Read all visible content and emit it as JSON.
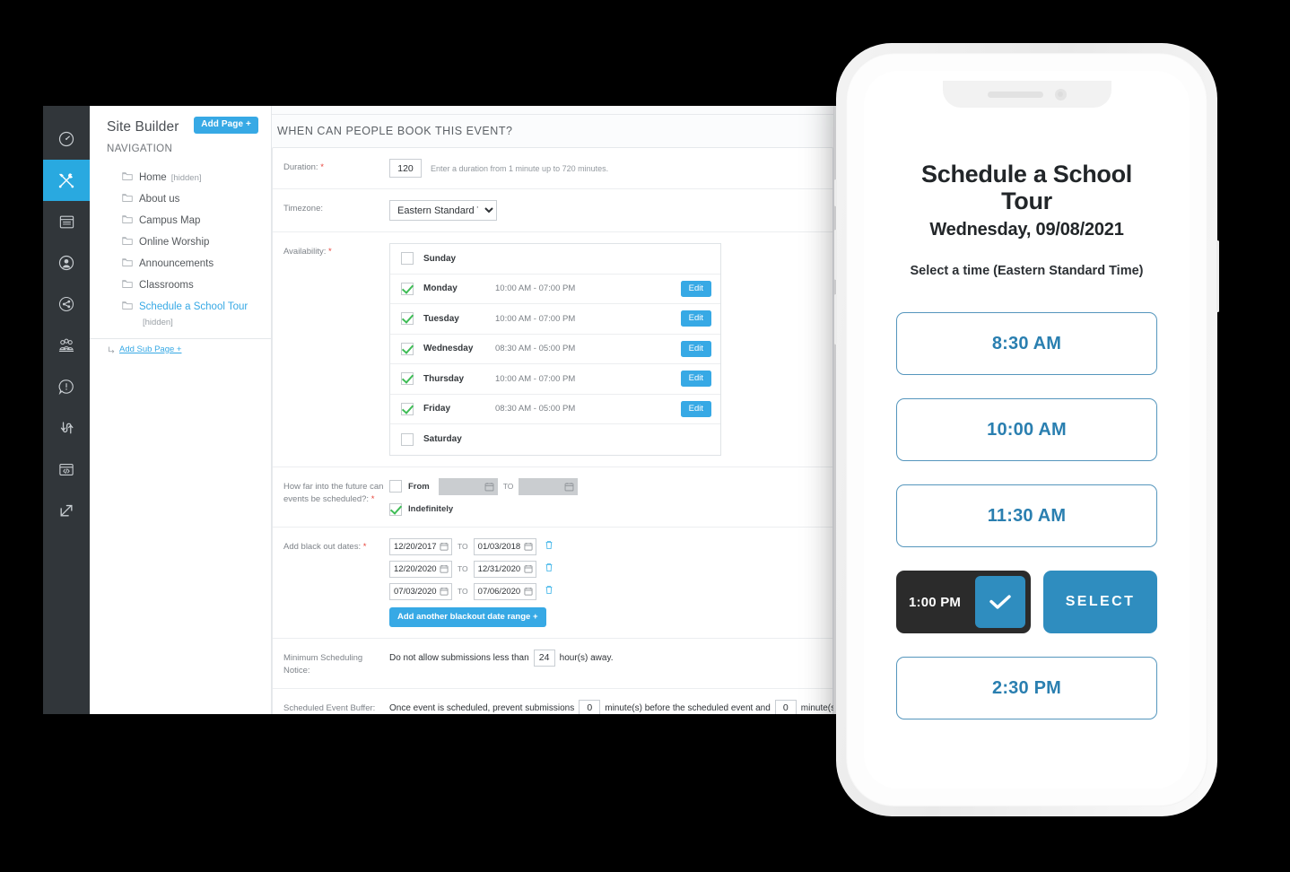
{
  "browser": {
    "rail": [
      {
        "name": "dashboard-icon",
        "label": "Dashboard",
        "active": false
      },
      {
        "name": "tools-icon",
        "label": "Site Builder",
        "active": true
      },
      {
        "name": "pages-icon",
        "label": "Pages",
        "active": false
      },
      {
        "name": "user-icon",
        "label": "Users",
        "active": false
      },
      {
        "name": "share-icon",
        "label": "Share",
        "active": false
      },
      {
        "name": "group-icon",
        "label": "Groups",
        "active": false
      },
      {
        "name": "alert-icon",
        "label": "Alerts",
        "active": false
      },
      {
        "name": "transfer-icon",
        "label": "Transfer",
        "active": false
      },
      {
        "name": "code-icon",
        "label": "Code",
        "active": false
      },
      {
        "name": "external-link-icon",
        "label": "Open Site",
        "active": false
      }
    ],
    "sidebar": {
      "title": "Site Builder",
      "add_page_label": "Add Page +",
      "nav_heading": "NAVIGATION",
      "add_sub_page_label": "Add Sub Page +",
      "items": [
        {
          "label": "Home",
          "tag": "[hidden]",
          "selected": false
        },
        {
          "label": "About us",
          "tag": "",
          "selected": false
        },
        {
          "label": "Campus Map",
          "tag": "",
          "selected": false
        },
        {
          "label": "Online Worship",
          "tag": "",
          "selected": false
        },
        {
          "label": "Announcements",
          "tag": "",
          "selected": false
        },
        {
          "label": "Classrooms",
          "tag": "",
          "selected": false
        },
        {
          "label": "Schedule a School Tour",
          "tag": "",
          "selected": true,
          "sub_tag": "[hidden]"
        }
      ]
    },
    "form": {
      "section_title": "WHEN CAN PEOPLE BOOK THIS EVENT?",
      "duration": {
        "label": "Duration:",
        "required": true,
        "value": "120",
        "hint": "Enter a duration from 1 minute up to 720 minutes."
      },
      "timezone": {
        "label": "Timezone:",
        "required": false,
        "value": "Eastern Standard Time",
        "options": [
          "Eastern Standard Time"
        ]
      },
      "availability": {
        "label": "Availability:",
        "required": true,
        "edit_label": "Edit",
        "days": [
          {
            "day": "Sunday",
            "checked": false,
            "time": "",
            "has_edit": false
          },
          {
            "day": "Monday",
            "checked": true,
            "time": "10:00 AM - 07:00 PM",
            "has_edit": true
          },
          {
            "day": "Tuesday",
            "checked": true,
            "time": "10:00 AM - 07:00 PM",
            "has_edit": true
          },
          {
            "day": "Wednesday",
            "checked": true,
            "time": "08:30 AM - 05:00 PM",
            "has_edit": true
          },
          {
            "day": "Thursday",
            "checked": true,
            "time": "10:00 AM - 07:00 PM",
            "has_edit": true
          },
          {
            "day": "Friday",
            "checked": true,
            "time": "08:30 AM - 05:00 PM",
            "has_edit": true
          },
          {
            "day": "Saturday",
            "checked": false,
            "time": "",
            "has_edit": false
          }
        ]
      },
      "future": {
        "label": "How far into the future can events be scheduled?:",
        "required": true,
        "from_label": "From",
        "from_checked": false,
        "from_value": "",
        "to_label": "TO",
        "to_value": "",
        "indefinitely_label": "Indefinitely",
        "indefinitely_checked": true
      },
      "blackout": {
        "label": "Add black out dates:",
        "required": true,
        "to_label": "TO",
        "add_button_label": "Add another blackout date range +",
        "ranges": [
          {
            "start": "12/20/2017",
            "end": "01/03/2018"
          },
          {
            "start": "12/20/2020",
            "end": "12/31/2020"
          },
          {
            "start": "07/03/2020",
            "end": "07/06/2020"
          }
        ]
      },
      "min_notice": {
        "label": "Minimum Scheduling Notice:",
        "text_before": "Do not allow submissions less than",
        "value": "24",
        "text_after": "hour(s) away."
      },
      "event_buffer": {
        "label": "Scheduled Event Buffer:",
        "text_before": "Once event is scheduled, prevent submissions",
        "value_before": "0",
        "text_middle": "minute(s) before the scheduled event and",
        "value_after": "0",
        "text_after": "minute(s) af"
      }
    }
  },
  "phone": {
    "title": "Schedule a School Tour",
    "date": "Wednesday, 09/08/2021",
    "subtitle": "Select a time (Eastern Standard Time)",
    "select_button_label": "SELECT",
    "slots": [
      {
        "time": "8:30 AM",
        "selected": false
      },
      {
        "time": "10:00 AM",
        "selected": false
      },
      {
        "time": "11:30 AM",
        "selected": false
      },
      {
        "time": "1:00 PM",
        "selected": true
      },
      {
        "time": "2:30 PM",
        "selected": false
      }
    ]
  },
  "colors": {
    "accent_blue": "#37a9e5",
    "phone_blue": "#2f8dbf",
    "slot_border": "#5596bd",
    "check_green": "#3fbd56",
    "rail_bg": "#31363a",
    "required_red": "#e8433a"
  }
}
